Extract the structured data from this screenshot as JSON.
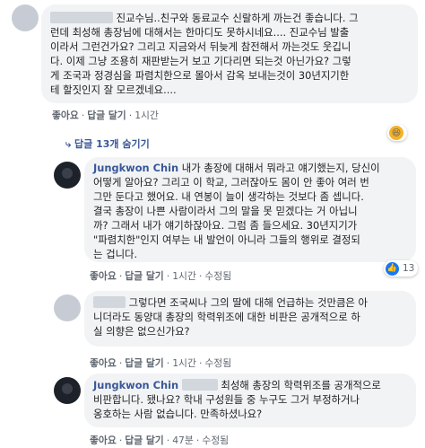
{
  "comment1": {
    "lines": [
      "진교수님..친구와 동료교수 신랄하게 까는건 좋습니다. 그",
      "런데 최성해 총장님에 대해서는 한마디도 못하시네요.... 진교수님 발출",
      "이라서 그런건가요? 그리고 지금와서 뒤늦게 참전해서 까는것도 웃깁니",
      "다. 이제 그냥 조용히 재판받는거 보고 기다리면 되는것 아닌가요? 그렇",
      "게 조국과 정경심을 파렴치한으로 몰아서 감옥 보내는것이 30년지기한",
      "테 할짓인지 잘 모르겠네요...."
    ],
    "actions": {
      "like": "좋아요",
      "reply": "답글 달기",
      "time": "1시간"
    }
  },
  "replies_toggle": "답글 13개 숨기기",
  "reply1": {
    "author": "Jungkwon Chin",
    "first_line": "내가 총장에 대해서 뭐라고 얘기했는지, 당신이",
    "lines": [
      "어떻게 알아요? 그리고 이 학교, 그러잖아도 몸이 안 좋아 여러 번",
      "그만 둔다고 했어요. 내 연봉이 늘이 생각하는 것보다 좀 셉니다.",
      "결국 총장이 나쁜 사람이라서 그의 말을 못 믿겠다는 거 아닙니",
      "까? 그래서 내가 얘기하잖아요. 그럼 좀 들으세요. 30년지기가",
      "\"파렴치한\"인지 여부는 내 발언이 아니라 그들의 행위로 결정되",
      "는 겁니다."
    ],
    "reactions": "13",
    "actions": {
      "like": "좋아요",
      "reply": "답글 달기",
      "time": "1시간",
      "edited": "수정됨"
    }
  },
  "reply2": {
    "lines": [
      "그렇다면 조국씨나 그의 딸에 대해 언급하는 것만큼은 아",
      "니더라도 동양대 총장의 학력위조에 대한 비판은 공개적으로 하",
      "실 의향은 없으신가요?"
    ],
    "actions": {
      "like": "좋아요",
      "reply": "답글 달기",
      "time": "1시간",
      "edited": "수정됨"
    }
  },
  "reply3": {
    "author": "Jungkwon Chin",
    "first_line": "최성해 총장의 학력위조를 공개적으로",
    "lines": [
      "비판합니다. 됐나요? 학내 구성원들 중 누구도 그거 부정하거나",
      "옹호하는 사람 없습니다. 만족하셨나요?"
    ],
    "actions": {
      "like": "좋아요",
      "reply": "답글 달기",
      "time": "47분",
      "edited": "수정됨"
    }
  },
  "colors": {
    "author": "#385898",
    "bubble": "#f2f3f5",
    "like_blue": "#1877f2",
    "haha_yellow": "#f7b125"
  },
  "icons": {
    "like_icon": "thumbs-up",
    "haha_icon": "laughing-face",
    "reply_arrow": "reply-arrow"
  }
}
